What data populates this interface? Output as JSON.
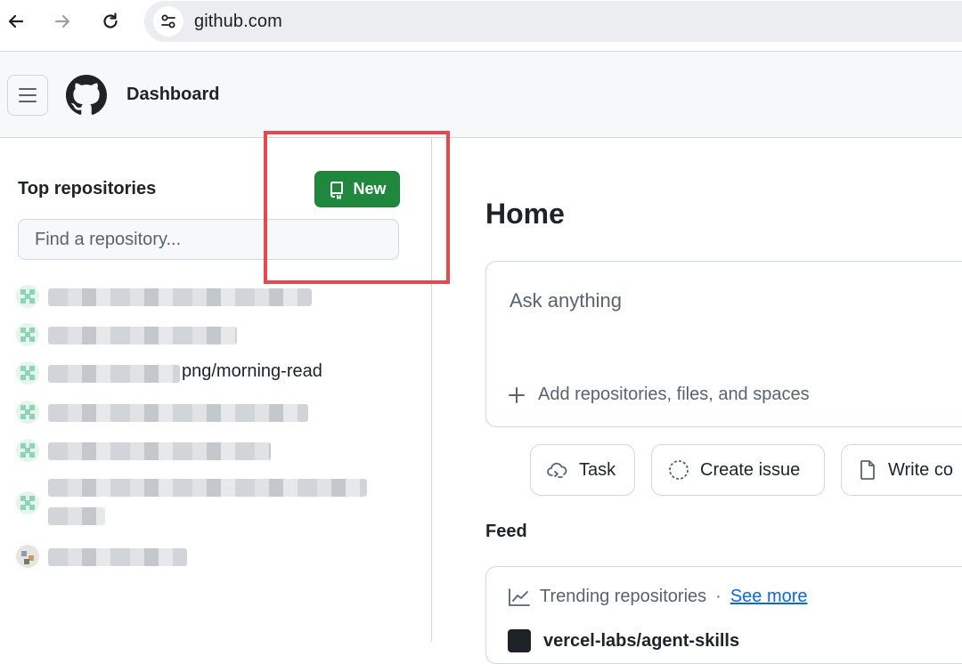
{
  "browser": {
    "url": "github.com",
    "icons": [
      "back-arrow-icon",
      "forward-arrow-icon",
      "reload-icon",
      "site-settings-icon"
    ]
  },
  "header": {
    "title": "Dashboard",
    "icons": [
      "hamburger-menu-icon",
      "github-logo-icon"
    ]
  },
  "sidebar": {
    "heading": "Top repositories",
    "new_button_label": "New",
    "search_placeholder": "Find a repository...",
    "repos": [
      {
        "name": "",
        "blurred": true
      },
      {
        "name": "",
        "blurred": true
      },
      {
        "name": "png/morning-read",
        "blurred_prefix": true
      },
      {
        "name": "",
        "blurred": true
      },
      {
        "name": "",
        "blurred": true
      },
      {
        "name": "",
        "blurred": true
      },
      {
        "name": "",
        "blurred": true
      }
    ]
  },
  "main": {
    "title": "Home",
    "ask_placeholder": "Ask anything",
    "add_context": "Add repositories, files, and spaces",
    "actions": [
      {
        "label": "Task",
        "icon": "cloud-task-icon"
      },
      {
        "label": "Create issue",
        "icon": "issue-circle-icon"
      },
      {
        "label": "Write co",
        "icon": "file-icon"
      }
    ],
    "feed_title": "Feed",
    "feed": {
      "label": "Trending repositories",
      "separator": "·",
      "see_more": "See more",
      "top_repo": "vercel-labs/agent-skills"
    }
  },
  "colors": {
    "new_button": "#1f883d",
    "link": "#0969da",
    "highlight_box": "#e5484d"
  }
}
